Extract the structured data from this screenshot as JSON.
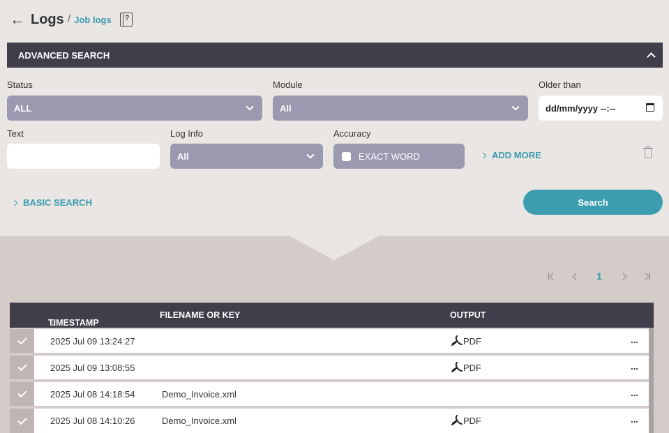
{
  "header": {
    "title": "Logs",
    "separator": "/",
    "breadcrumb": "Job logs",
    "doc_icon_glyph": "?"
  },
  "advanced_search": {
    "bar_label": "ADVANCED SEARCH",
    "status": {
      "label": "Status",
      "value": "ALL"
    },
    "module": {
      "label": "Module",
      "value": "All"
    },
    "older_than": {
      "label": "Older than",
      "value": "dd/mm/yyyy --:--"
    },
    "text": {
      "label": "Text",
      "value": ""
    },
    "log_info": {
      "label": "Log Info",
      "value": "All"
    },
    "accuracy": {
      "label": "Accuracy",
      "option": "EXACT WORD",
      "checked": false
    },
    "add_more": "ADD MORE",
    "basic_search": "BASIC SEARCH",
    "search_button": "Search"
  },
  "pagination": {
    "current_page": "1"
  },
  "table": {
    "columns": [
      "TIMESTAMP",
      "FILENAME OR KEY",
      "OUTPUT"
    ],
    "sort_indicator": "↓",
    "rows": [
      {
        "timestamp": "2025 Jul 09 13:24:27",
        "filename": "",
        "output": "PDF",
        "more": "..."
      },
      {
        "timestamp": "2025 Jul 09 13:08:55",
        "filename": "",
        "output": "PDF",
        "more": "..."
      },
      {
        "timestamp": "2025 Jul 08 14:18:54",
        "filename": "Demo_Invoice.xml",
        "output": "",
        "more": "..."
      },
      {
        "timestamp": "2025 Jul 08 14:10:26",
        "filename": "Demo_Invoice.xml",
        "output": "PDF",
        "more": "..."
      }
    ]
  },
  "colors": {
    "accent": "#3a9aaf",
    "dark_bar": "#3f3e4a",
    "select_bg": "#9b99af",
    "page_bg": "#e9e6e3",
    "lower_bg": "#d3ccc8"
  },
  "icons": [
    "back-arrow-icon",
    "document-help-icon",
    "chevron-up-icon",
    "chevron-down-icon",
    "calendar-icon",
    "chevron-right-icon",
    "trash-icon",
    "first-page-icon",
    "prev-page-icon",
    "next-page-icon",
    "last-page-icon",
    "check-icon",
    "pdf-icon",
    "more-icon"
  ]
}
